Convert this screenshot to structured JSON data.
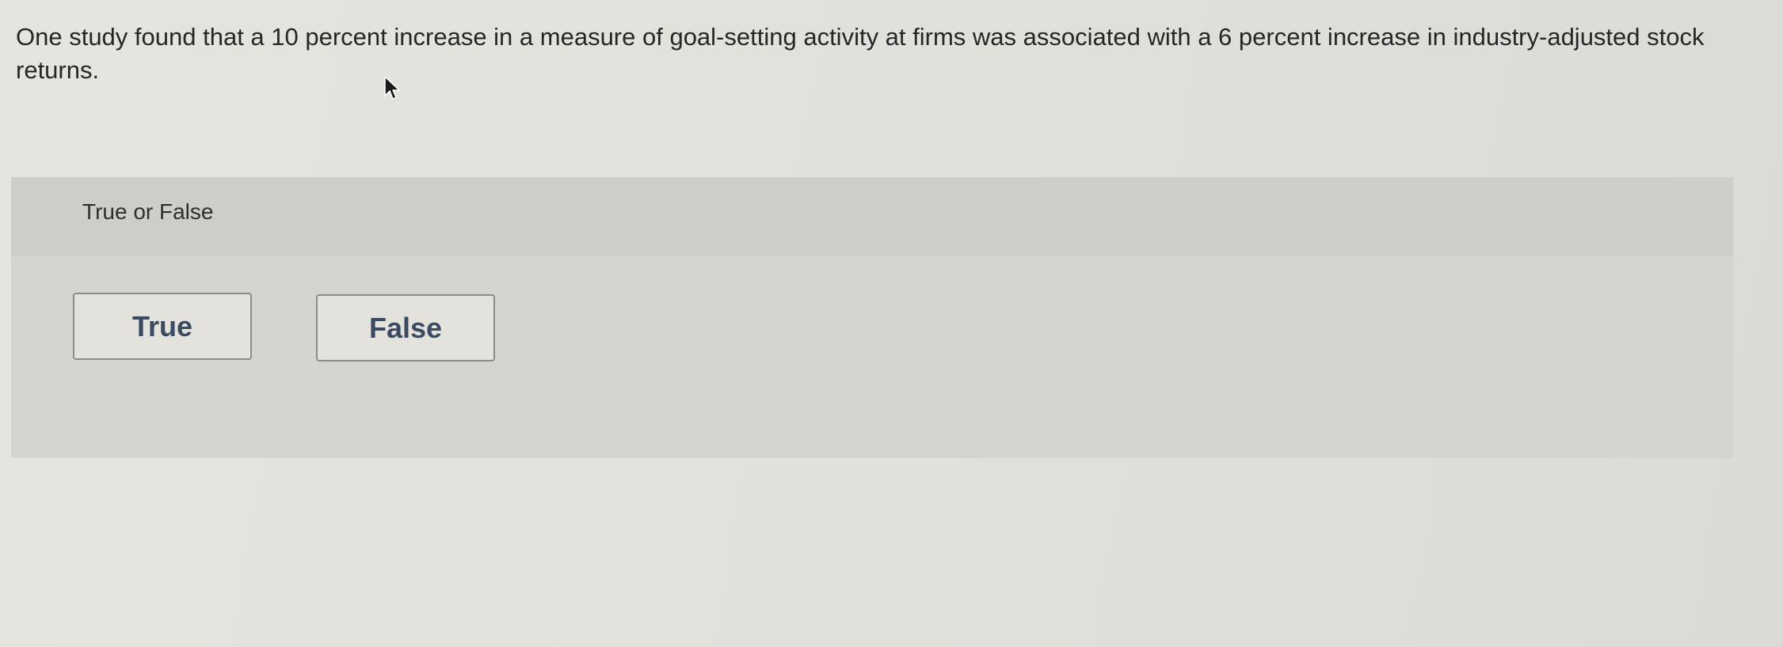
{
  "question": {
    "text": "One study found that a 10 percent increase in a measure of goal-setting activity at firms was associated with a 6 percent increase in industry-adjusted stock returns."
  },
  "answer_panel": {
    "header": "True or False",
    "options": [
      {
        "label": "True"
      },
      {
        "label": "False"
      }
    ]
  },
  "colors": {
    "button_text": "#3a4a60",
    "panel_bg": "#d6d4cf",
    "header_bg": "#cfcdc8"
  },
  "icons": {
    "cursor": "mouse-pointer-icon"
  }
}
